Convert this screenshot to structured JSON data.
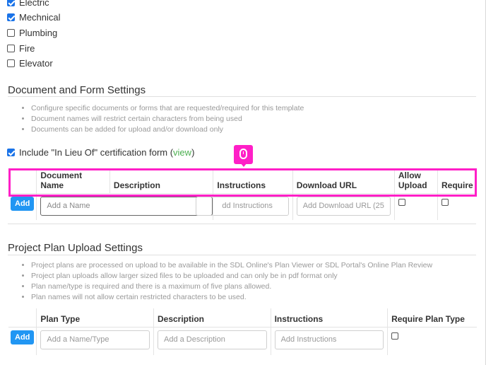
{
  "trade_checkboxes": [
    {
      "label": "Electric",
      "checked": true
    },
    {
      "label": "Mechnical",
      "checked": true
    },
    {
      "label": "Plumbing",
      "checked": false
    },
    {
      "label": "Fire",
      "checked": false
    },
    {
      "label": "Elevator",
      "checked": false
    }
  ],
  "doc_section": {
    "title": "Document and Form Settings",
    "bullets": [
      "Configure specific documents or forms that are requested/required for this template",
      "Document names will restrict certain characters from being used",
      "Documents can be added for upload and/or download only"
    ],
    "lieu_prefix": "Include \"In Lieu Of\" certification form (",
    "lieu_link": "view",
    "lieu_suffix": ")",
    "columns": [
      "Document Name",
      "Description",
      "Instructions",
      "Download URL",
      "Allow Upload",
      "Require"
    ],
    "add_label": "Add",
    "name_placeholder": "Add a Name",
    "instructions_placeholder": "dd Instructions",
    "url_placeholder": "Add Download URL (25"
  },
  "plan_section": {
    "title": "Project Plan Upload Settings",
    "bullets": [
      "Project plans are processed on upload to be available in the SDL Online's Plan Viewer or SDL Portal's Online Plan Review",
      "Project plan uploads allow larger sized files to be uploaded and can only be in pdf format only",
      "Plan name/type is required and there is a maximum of five plans allowed.",
      "Plan names will not allow certain restricted characters to be used."
    ],
    "columns": [
      "Plan Type",
      "Description",
      "Instructions",
      "Require Plan Type"
    ],
    "add_label": "Add",
    "type_placeholder": "Add a Name/Type",
    "desc_placeholder": "Add a Description",
    "instr_placeholder": "Add Instructions"
  },
  "colors": {
    "accent": "#2196f3",
    "highlight": "#ff1fc7",
    "link": "#4caf50"
  }
}
